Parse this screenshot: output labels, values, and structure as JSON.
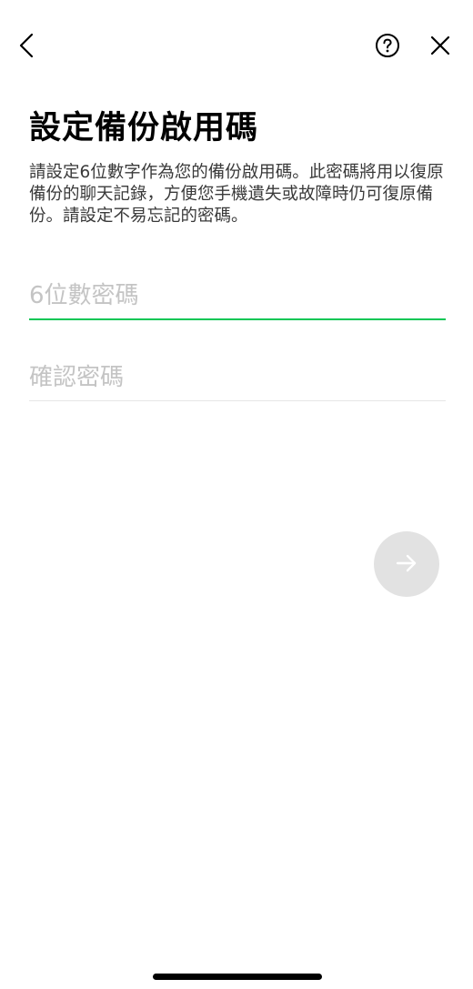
{
  "nav": {
    "back_icon": "chevron-left-icon",
    "help_icon": "question-circle-icon",
    "close_icon": "close-icon"
  },
  "title": "設定備份啟用碼",
  "description": "請設定6位數字作為您的備份啟用碼。此密碼將用以復原備份的聊天記錄，方便您手機遺失或故障時仍可復原備份。請設定不易忘記的密碼。",
  "form": {
    "password": {
      "value": "",
      "placeholder": "6位數密碼"
    },
    "confirm": {
      "value": "",
      "placeholder": "確認密碼"
    }
  },
  "next_button": {
    "icon": "arrow-right-icon",
    "enabled": false
  },
  "colors": {
    "accent": "#06c755",
    "disabled_button": "#e2e2e2",
    "placeholder": "#c4c4c4"
  }
}
